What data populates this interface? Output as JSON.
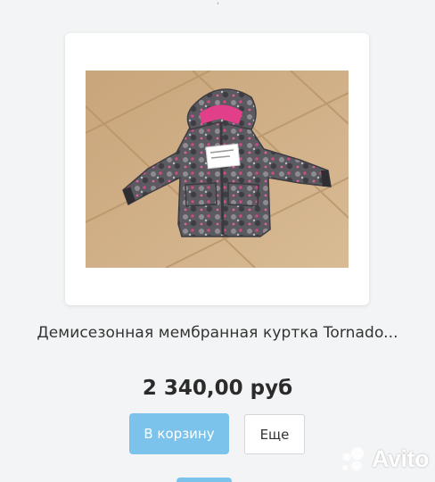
{
  "product": {
    "title": "Демисезонная мембранная куртка Tornado...",
    "price": "2 340,00 руб",
    "image_icon": "jacket-photo"
  },
  "actions": {
    "cart_label": "В корзину",
    "more_label": "Еще"
  },
  "colors": {
    "background": "#f3f4f5",
    "cart_button": "#7cc3ec",
    "price_text": "#2b2b2b"
  },
  "watermark": {
    "text": "Avito",
    "icon": "avito-logo-icon"
  }
}
